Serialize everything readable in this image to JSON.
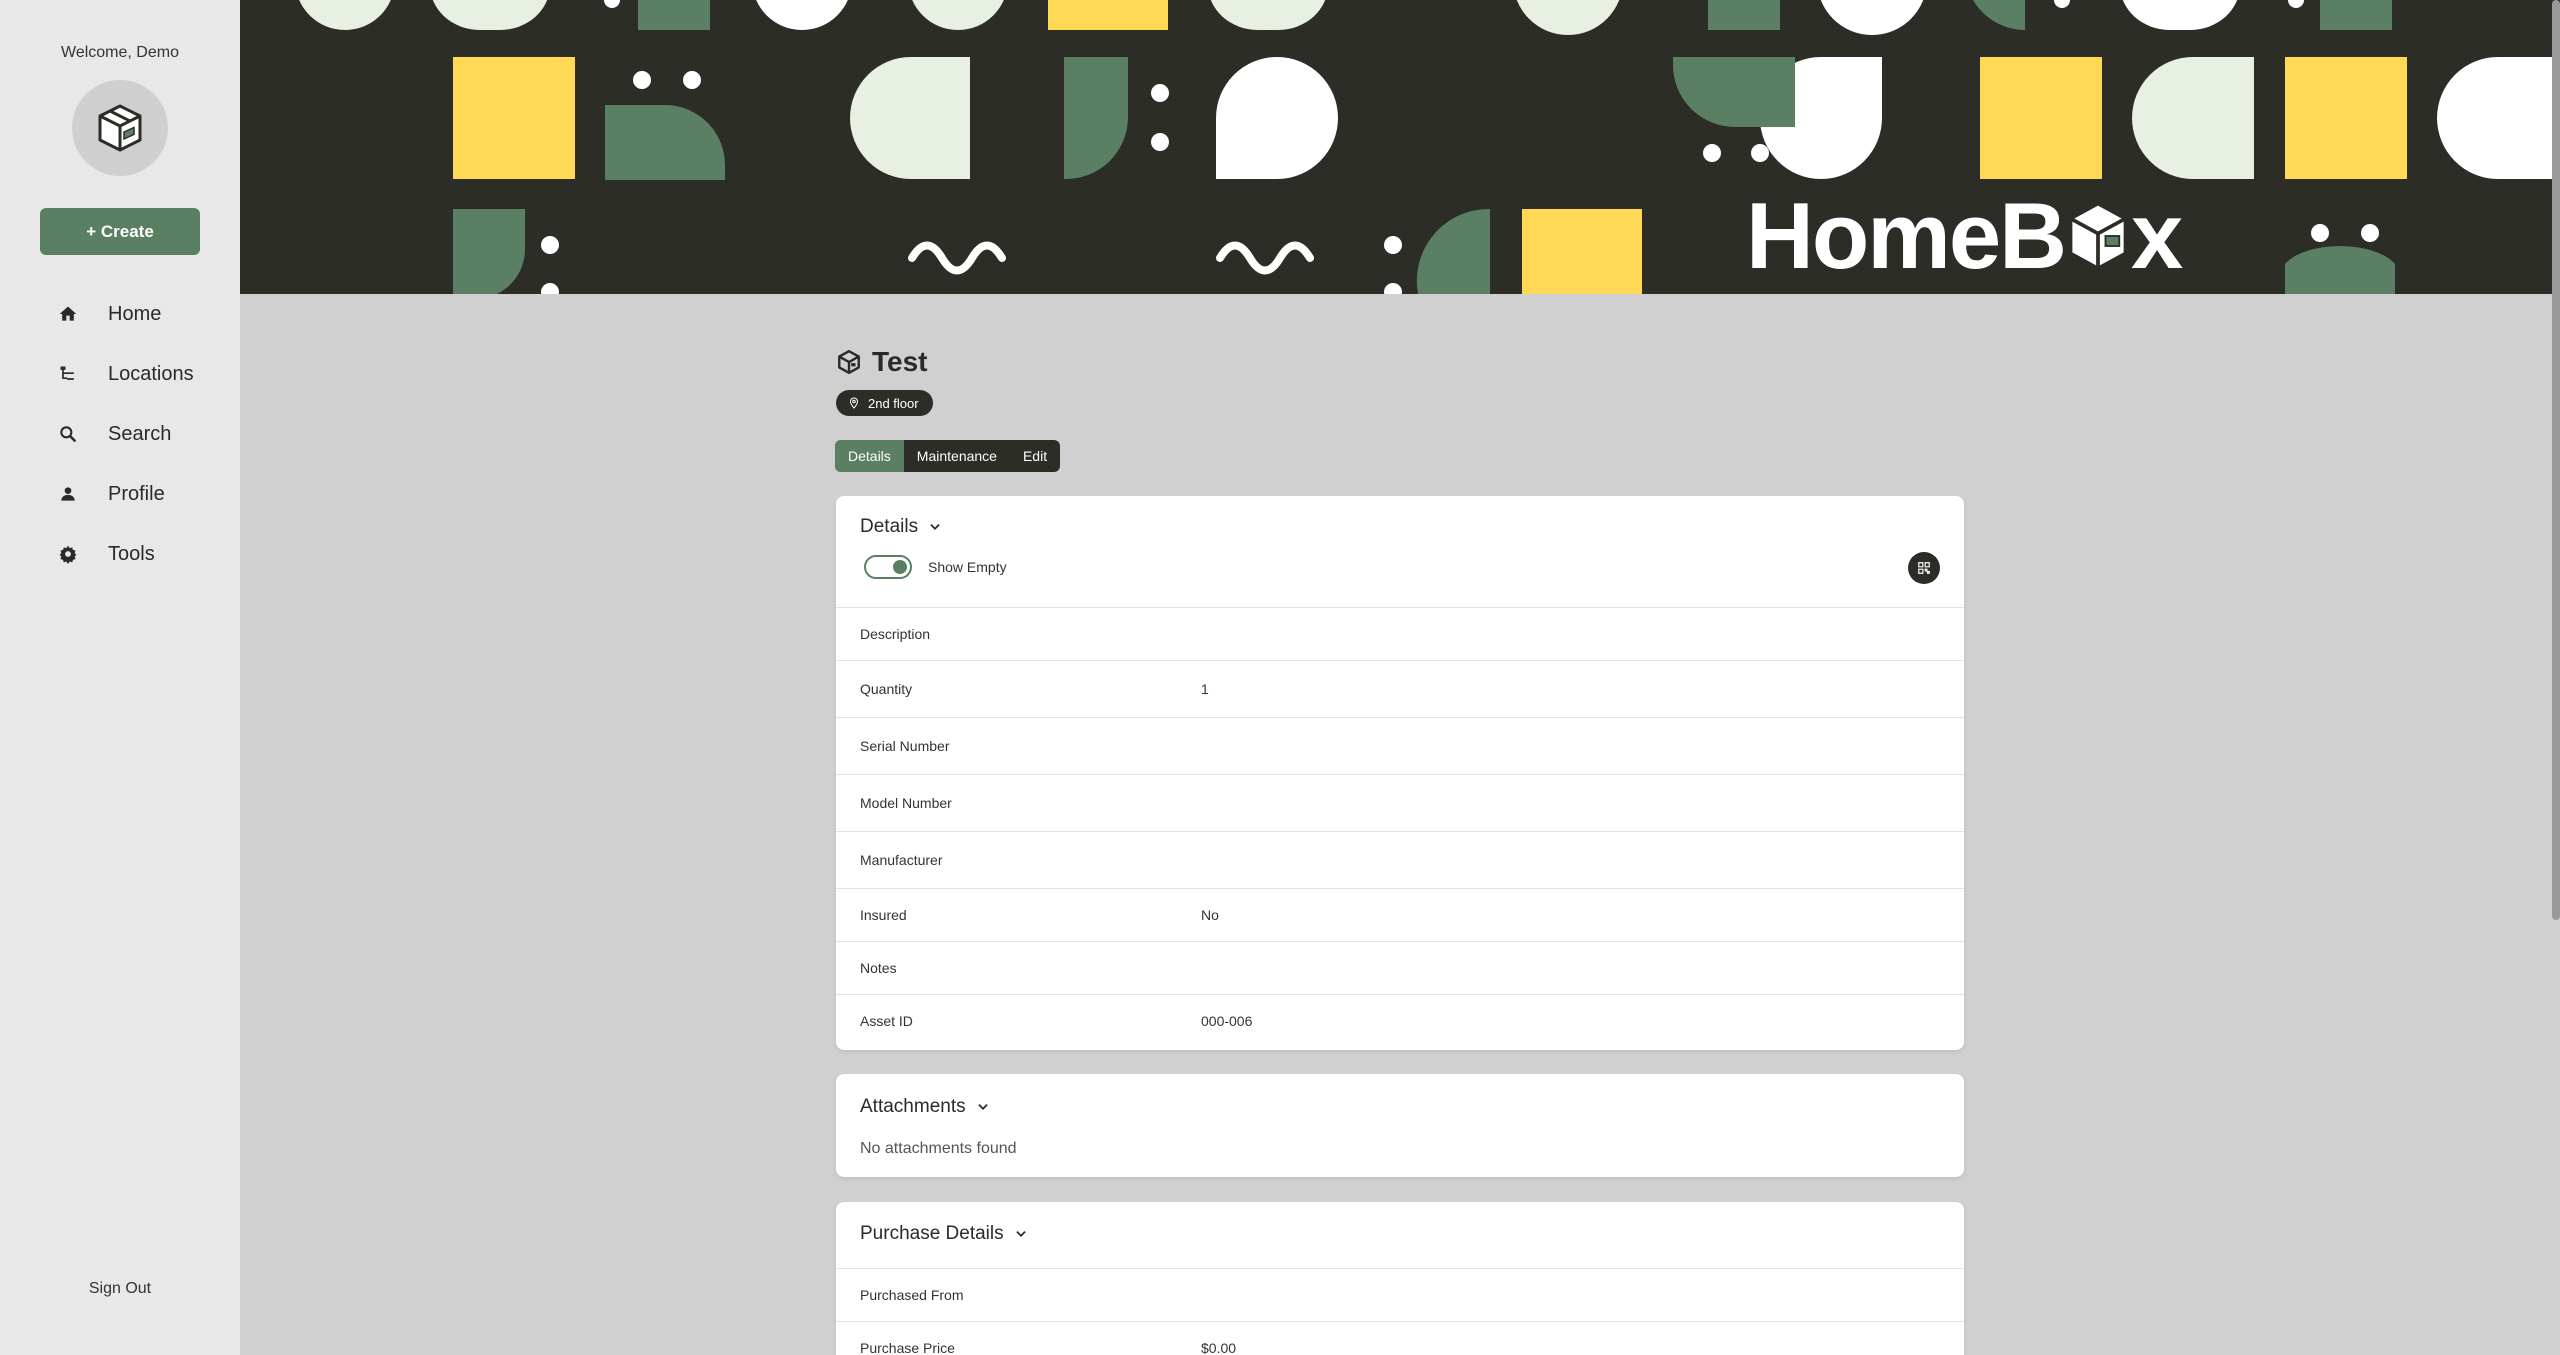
{
  "sidebar": {
    "welcome": "Welcome, Demo",
    "create_label": "+ Create",
    "items": [
      {
        "label": "Home",
        "icon": "home-icon"
      },
      {
        "label": "Locations",
        "icon": "locations-icon"
      },
      {
        "label": "Search",
        "icon": "search-icon"
      },
      {
        "label": "Profile",
        "icon": "profile-icon"
      },
      {
        "label": "Tools",
        "icon": "gear-icon"
      }
    ],
    "sign_out": "Sign Out"
  },
  "banner": {
    "logo_text_a": "HomeB",
    "logo_text_b": "x"
  },
  "item": {
    "title": "Test",
    "location": "2nd floor"
  },
  "tabs": [
    "Details",
    "Maintenance",
    "Edit"
  ],
  "details": {
    "header": "Details",
    "show_empty_label": "Show Empty",
    "rows": [
      {
        "label": "Description",
        "value": ""
      },
      {
        "label": "Quantity",
        "value": "1"
      },
      {
        "label": "Serial Number",
        "value": ""
      },
      {
        "label": "Model Number",
        "value": ""
      },
      {
        "label": "Manufacturer",
        "value": ""
      },
      {
        "label": "Insured",
        "value": "No"
      },
      {
        "label": "Notes",
        "value": ""
      },
      {
        "label": "Asset ID",
        "value": "000-006"
      }
    ]
  },
  "attachments": {
    "header": "Attachments",
    "empty_text": "No attachments found"
  },
  "purchase": {
    "header": "Purchase Details",
    "rows": [
      {
        "label": "Purchased From",
        "value": ""
      },
      {
        "label": "Purchase Price",
        "value": "$0.00"
      }
    ]
  },
  "colors": {
    "accent": "#5a7f63",
    "dark": "#2b2d26",
    "yellow": "#ffd955",
    "mint": "#e8f0e4"
  }
}
